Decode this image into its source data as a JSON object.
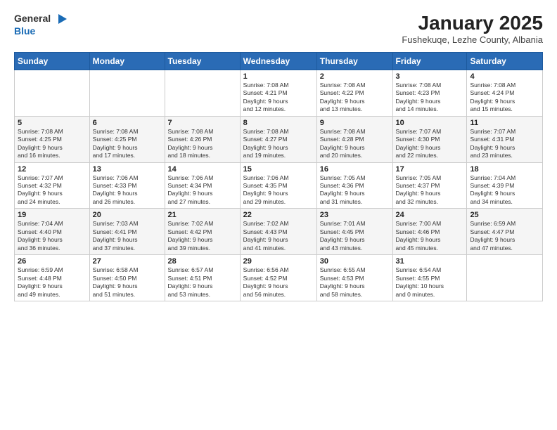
{
  "header": {
    "logo_general": "General",
    "logo_blue": "Blue",
    "title": "January 2025",
    "subtitle": "Fushekuqe, Lezhe County, Albania"
  },
  "weekdays": [
    "Sunday",
    "Monday",
    "Tuesday",
    "Wednesday",
    "Thursday",
    "Friday",
    "Saturday"
  ],
  "weeks": [
    [
      {
        "day": "",
        "info": ""
      },
      {
        "day": "",
        "info": ""
      },
      {
        "day": "",
        "info": ""
      },
      {
        "day": "1",
        "info": "Sunrise: 7:08 AM\nSunset: 4:21 PM\nDaylight: 9 hours\nand 12 minutes."
      },
      {
        "day": "2",
        "info": "Sunrise: 7:08 AM\nSunset: 4:22 PM\nDaylight: 9 hours\nand 13 minutes."
      },
      {
        "day": "3",
        "info": "Sunrise: 7:08 AM\nSunset: 4:23 PM\nDaylight: 9 hours\nand 14 minutes."
      },
      {
        "day": "4",
        "info": "Sunrise: 7:08 AM\nSunset: 4:24 PM\nDaylight: 9 hours\nand 15 minutes."
      }
    ],
    [
      {
        "day": "5",
        "info": "Sunrise: 7:08 AM\nSunset: 4:25 PM\nDaylight: 9 hours\nand 16 minutes."
      },
      {
        "day": "6",
        "info": "Sunrise: 7:08 AM\nSunset: 4:25 PM\nDaylight: 9 hours\nand 17 minutes."
      },
      {
        "day": "7",
        "info": "Sunrise: 7:08 AM\nSunset: 4:26 PM\nDaylight: 9 hours\nand 18 minutes."
      },
      {
        "day": "8",
        "info": "Sunrise: 7:08 AM\nSunset: 4:27 PM\nDaylight: 9 hours\nand 19 minutes."
      },
      {
        "day": "9",
        "info": "Sunrise: 7:08 AM\nSunset: 4:28 PM\nDaylight: 9 hours\nand 20 minutes."
      },
      {
        "day": "10",
        "info": "Sunrise: 7:07 AM\nSunset: 4:30 PM\nDaylight: 9 hours\nand 22 minutes."
      },
      {
        "day": "11",
        "info": "Sunrise: 7:07 AM\nSunset: 4:31 PM\nDaylight: 9 hours\nand 23 minutes."
      }
    ],
    [
      {
        "day": "12",
        "info": "Sunrise: 7:07 AM\nSunset: 4:32 PM\nDaylight: 9 hours\nand 24 minutes."
      },
      {
        "day": "13",
        "info": "Sunrise: 7:06 AM\nSunset: 4:33 PM\nDaylight: 9 hours\nand 26 minutes."
      },
      {
        "day": "14",
        "info": "Sunrise: 7:06 AM\nSunset: 4:34 PM\nDaylight: 9 hours\nand 27 minutes."
      },
      {
        "day": "15",
        "info": "Sunrise: 7:06 AM\nSunset: 4:35 PM\nDaylight: 9 hours\nand 29 minutes."
      },
      {
        "day": "16",
        "info": "Sunrise: 7:05 AM\nSunset: 4:36 PM\nDaylight: 9 hours\nand 31 minutes."
      },
      {
        "day": "17",
        "info": "Sunrise: 7:05 AM\nSunset: 4:37 PM\nDaylight: 9 hours\nand 32 minutes."
      },
      {
        "day": "18",
        "info": "Sunrise: 7:04 AM\nSunset: 4:39 PM\nDaylight: 9 hours\nand 34 minutes."
      }
    ],
    [
      {
        "day": "19",
        "info": "Sunrise: 7:04 AM\nSunset: 4:40 PM\nDaylight: 9 hours\nand 36 minutes."
      },
      {
        "day": "20",
        "info": "Sunrise: 7:03 AM\nSunset: 4:41 PM\nDaylight: 9 hours\nand 37 minutes."
      },
      {
        "day": "21",
        "info": "Sunrise: 7:02 AM\nSunset: 4:42 PM\nDaylight: 9 hours\nand 39 minutes."
      },
      {
        "day": "22",
        "info": "Sunrise: 7:02 AM\nSunset: 4:43 PM\nDaylight: 9 hours\nand 41 minutes."
      },
      {
        "day": "23",
        "info": "Sunrise: 7:01 AM\nSunset: 4:45 PM\nDaylight: 9 hours\nand 43 minutes."
      },
      {
        "day": "24",
        "info": "Sunrise: 7:00 AM\nSunset: 4:46 PM\nDaylight: 9 hours\nand 45 minutes."
      },
      {
        "day": "25",
        "info": "Sunrise: 6:59 AM\nSunset: 4:47 PM\nDaylight: 9 hours\nand 47 minutes."
      }
    ],
    [
      {
        "day": "26",
        "info": "Sunrise: 6:59 AM\nSunset: 4:48 PM\nDaylight: 9 hours\nand 49 minutes."
      },
      {
        "day": "27",
        "info": "Sunrise: 6:58 AM\nSunset: 4:50 PM\nDaylight: 9 hours\nand 51 minutes."
      },
      {
        "day": "28",
        "info": "Sunrise: 6:57 AM\nSunset: 4:51 PM\nDaylight: 9 hours\nand 53 minutes."
      },
      {
        "day": "29",
        "info": "Sunrise: 6:56 AM\nSunset: 4:52 PM\nDaylight: 9 hours\nand 56 minutes."
      },
      {
        "day": "30",
        "info": "Sunrise: 6:55 AM\nSunset: 4:53 PM\nDaylight: 9 hours\nand 58 minutes."
      },
      {
        "day": "31",
        "info": "Sunrise: 6:54 AM\nSunset: 4:55 PM\nDaylight: 10 hours\nand 0 minutes."
      },
      {
        "day": "",
        "info": ""
      }
    ]
  ]
}
